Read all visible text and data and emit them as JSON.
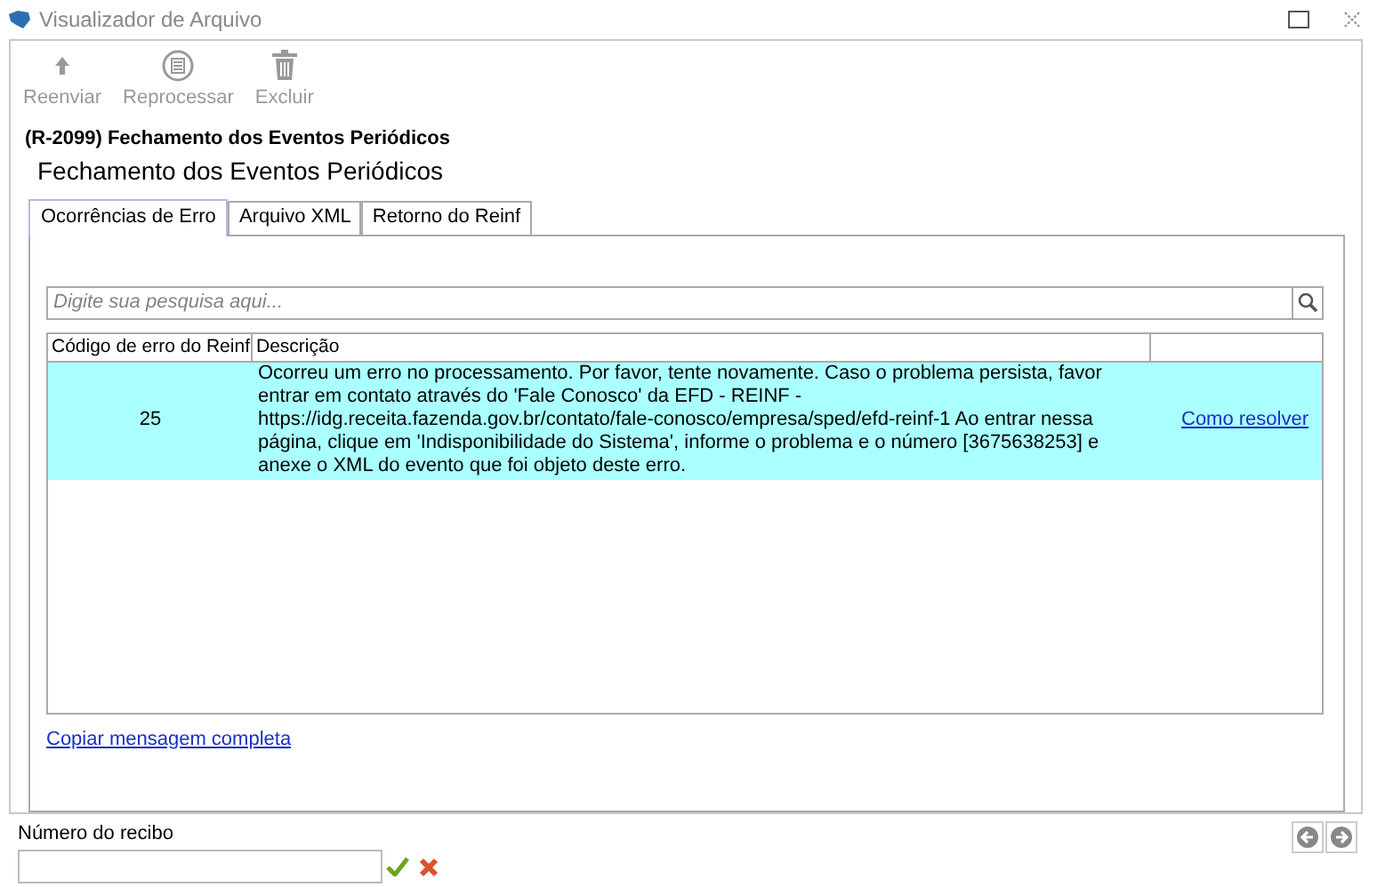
{
  "window": {
    "title": "Visualizador de Arquivo"
  },
  "toolbar": [
    {
      "kind": "upload",
      "label": "Reenviar",
      "disabled": true
    },
    {
      "kind": "reprocess",
      "label": "Reprocessar",
      "disabled": true
    },
    {
      "kind": "delete",
      "label": "Excluir",
      "disabled": true
    }
  ],
  "heading": "(R-2099) Fechamento dos Eventos Periódicos",
  "subtitle": "Fechamento dos Eventos Periódicos",
  "tabs": [
    {
      "label": "Ocorrências de Erro",
      "selected": true
    },
    {
      "label": "Arquivo XML",
      "selected": false
    },
    {
      "label": "Retorno do Reinf",
      "selected": false
    }
  ],
  "search": {
    "placeholder": "Digite sua pesquisa aqui..."
  },
  "table": {
    "columns": [
      "Código de erro do Reinf",
      "Descrição"
    ],
    "rows": [
      {
        "code": "25",
        "description": "Ocorreu um erro no processamento. Por favor, tente novamente. Caso o problema persista, favor entrar em contato através do 'Fale Conosco' da EFD - REINF - https://idg.receita.fazenda.gov.br/contato/fale-conosco/empresa/sped/efd-reinf-1 Ao entrar nessa página, clique em 'Indisponibilidade do Sistema', informe o problema e o número [3675638253] e anexe o XML do evento que foi objeto deste erro.",
        "link": "Como resolver",
        "selected": true
      }
    ]
  },
  "copy_link": "Copiar mensagem completa",
  "receipt": {
    "label": "Número do recibo"
  }
}
